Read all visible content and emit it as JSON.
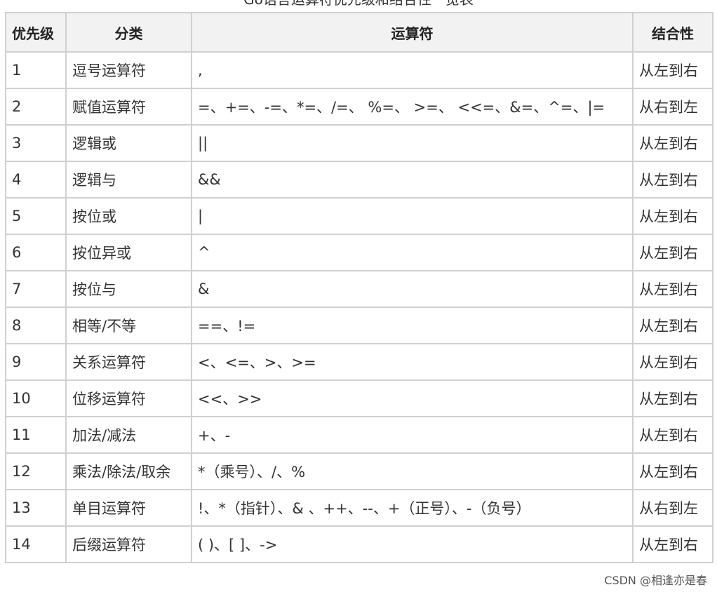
{
  "caption": "Go语言运算符优先级和结合性一览表",
  "headers": {
    "priority": "优先级",
    "category": "分类",
    "operators": "运算符",
    "associativity": "结合性"
  },
  "rows": [
    {
      "priority": "1",
      "category": "逗号运算符",
      "operators": ",",
      "associativity": "从左到右",
      "rtl": false
    },
    {
      "priority": "2",
      "category": "赋值运算符",
      "operators": "=、+=、-=、*=、/=、 %=、 >=、 <<=、&=、^=、|=",
      "associativity": "从右到左",
      "rtl": true
    },
    {
      "priority": "3",
      "category": "逻辑或",
      "operators": "||",
      "associativity": "从左到右",
      "rtl": false
    },
    {
      "priority": "4",
      "category": "逻辑与",
      "operators": "&&",
      "associativity": "从左到右",
      "rtl": false
    },
    {
      "priority": "5",
      "category": "按位或",
      "operators": "|",
      "associativity": "从左到右",
      "rtl": false
    },
    {
      "priority": "6",
      "category": "按位异或",
      "operators": "^",
      "associativity": "从左到右",
      "rtl": false
    },
    {
      "priority": "7",
      "category": "按位与",
      "operators": "&",
      "associativity": "从左到右",
      "rtl": false
    },
    {
      "priority": "8",
      "category": "相等/不等",
      "operators": "==、!=",
      "associativity": "从左到右",
      "rtl": false
    },
    {
      "priority": "9",
      "category": "关系运算符",
      "operators": "<、<=、>、>=",
      "associativity": "从左到右",
      "rtl": false
    },
    {
      "priority": "10",
      "category": "位移运算符",
      "operators": "<<、>>",
      "associativity": "从左到右",
      "rtl": false
    },
    {
      "priority": "11",
      "category": "加法/减法",
      "operators": "+、-",
      "associativity": "从左到右",
      "rtl": false
    },
    {
      "priority": "12",
      "category": "乘法/除法/取余",
      "operators": "*（乘号）、/、%",
      "associativity": "从左到右",
      "rtl": false
    },
    {
      "priority": "13",
      "category": "单目运算符",
      "operators": "!、*（指针）、& 、++、--、+（正号）、-（负号）",
      "associativity": "从右到左",
      "rtl": true
    },
    {
      "priority": "14",
      "category": "后缀运算符",
      "operators": "( )、[ ]、->",
      "associativity": "从左到右",
      "rtl": false
    }
  ],
  "watermark": "CSDN @相逢亦是春",
  "colors": {
    "header_bg": "#f2f2f2",
    "border": "#d0d0d0",
    "right_to_left_text": "#a33b3b"
  }
}
